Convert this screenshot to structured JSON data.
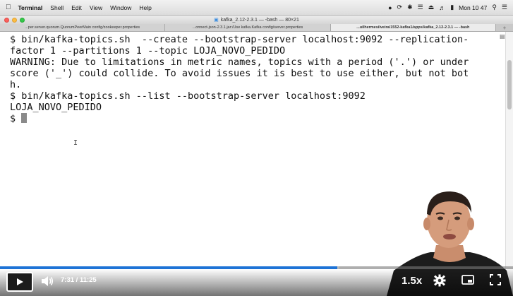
{
  "menubar": {
    "apple_icon": "apple-logo",
    "items": [
      "Terminal",
      "Shell",
      "Edit",
      "View",
      "Window",
      "Help"
    ],
    "clock": "Mon 10 47"
  },
  "window": {
    "title": "kafka_2.12-2.3.1 — -bash — 80×21",
    "tabs": [
      "...per.server.quorum.QuorumPeerMain config/zookeeper.properties",
      "...onnect-json-2.3.1.jar:/Use kafka.Kafka config/server.properties",
      "...uilhermesilveira/1552-kafka1/apps/kafka_2.12-2.3.1 — -bash"
    ],
    "active_tab": 2
  },
  "terminal": {
    "lines": [
      "$ bin/kafka-topics.sh  --create --bootstrap-server localhost:9092 --replication-",
      "factor 1 --partitions 1 --topic LOJA_NOVO_PEDIDO",
      "WARNING: Due to limitations in metric names, topics with a period ('.') or under",
      "score ('_') could collide. To avoid issues it is best to use either, but not bot",
      "h.",
      "$ bin/kafka-topics.sh --list --bootstrap-server localhost:9092",
      "LOJA_NOVO_PEDIDO",
      "$ "
    ]
  },
  "player": {
    "current_time": "7:31",
    "separator": "/",
    "duration": "11:25",
    "progress_fraction": 0.658,
    "buffered_fraction": 0.66,
    "playback_rate": "1.5x",
    "accent_color": "#1e73d6"
  }
}
